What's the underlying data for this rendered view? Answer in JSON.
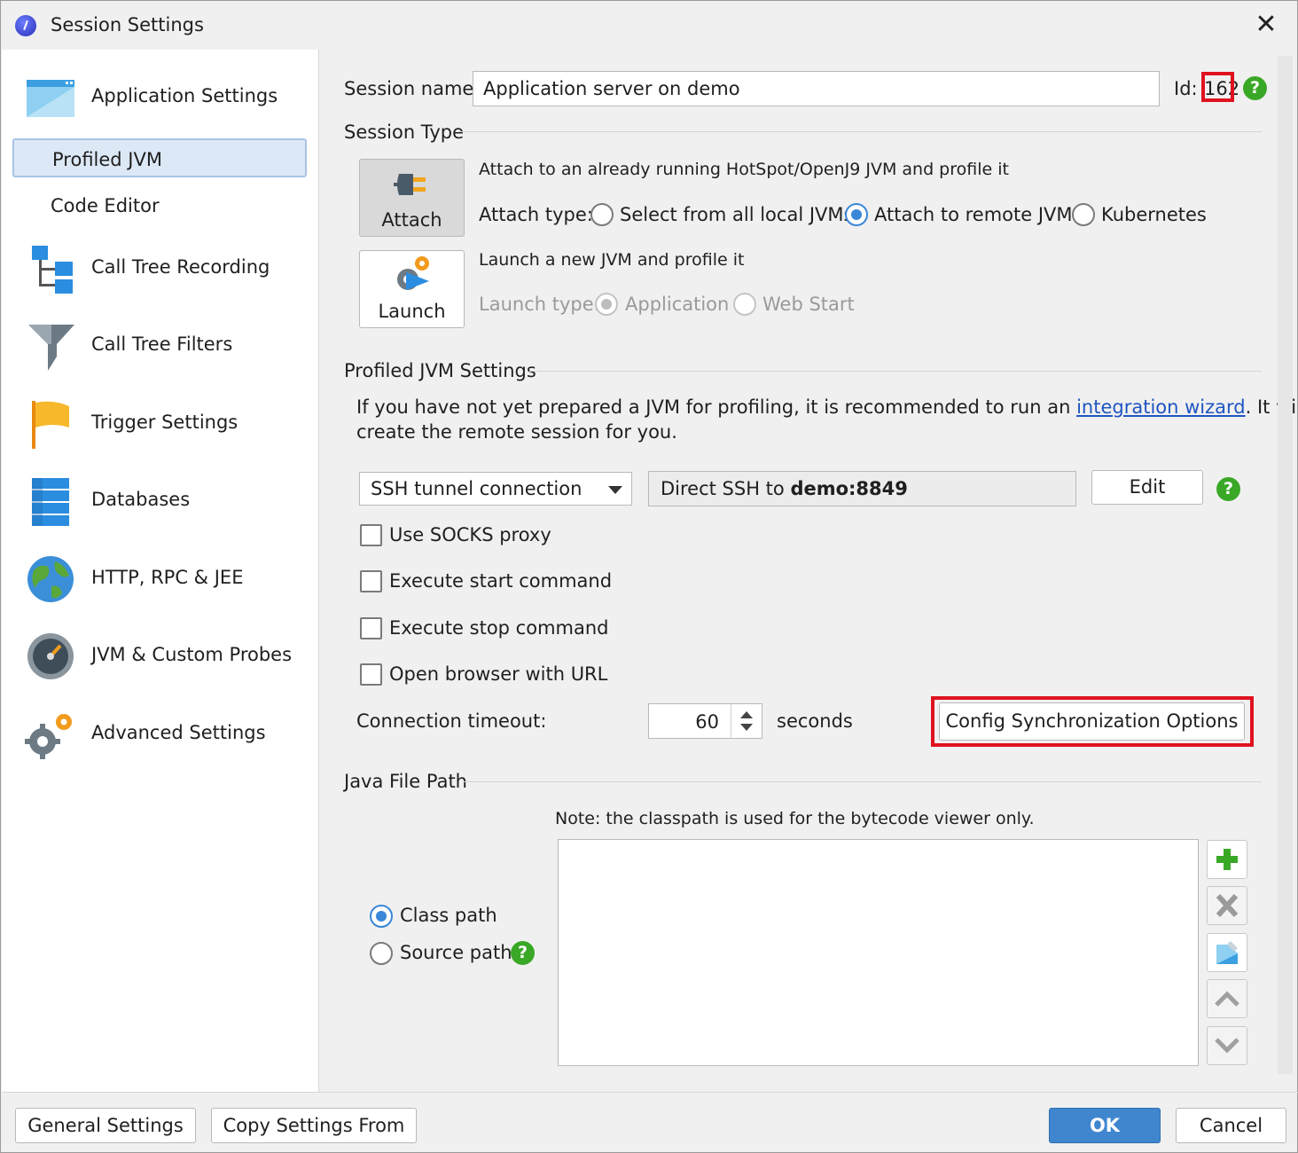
{
  "window": {
    "title": "Session Settings"
  },
  "sidebar": {
    "items": [
      {
        "label": "Application Settings"
      },
      {
        "label": "Profiled JVM"
      },
      {
        "label": "Code Editor"
      },
      {
        "label": "Call Tree Recording"
      },
      {
        "label": "Call Tree Filters"
      },
      {
        "label": "Trigger Settings"
      },
      {
        "label": "Databases"
      },
      {
        "label": "HTTP, RPC & JEE"
      },
      {
        "label": "JVM & Custom Probes"
      },
      {
        "label": "Advanced Settings"
      }
    ]
  },
  "session": {
    "name_label": "Session name:",
    "name_value": "Application server on demo",
    "id_label": "Id:",
    "id_value": "162"
  },
  "session_type": {
    "title": "Session Type",
    "attach_button": "Attach",
    "attach_desc": "Attach to an already running HotSpot/OpenJ9 JVM and profile it",
    "attach_type_label": "Attach type:",
    "attach_options": [
      "Select from all local JVMs",
      "Attach to remote JVM",
      "Kubernetes"
    ],
    "attach_selected": "Attach to remote JVM",
    "launch_button": "Launch",
    "launch_desc": "Launch a new JVM and profile it",
    "launch_type_label": "Launch type:",
    "launch_options": [
      "Application",
      "Web Start"
    ],
    "launch_selected": "Application"
  },
  "jvm_settings": {
    "title": "Profiled JVM Settings",
    "intro_before": "If you have not yet prepared a JVM for profiling, it is recommended to run an ",
    "intro_link": "integration wizard",
    "intro_after": ". It will",
    "intro_line2": "create the remote session for you.",
    "connection_type": "SSH tunnel connection",
    "connection_desc_prefix": "Direct SSH to ",
    "connection_desc_host": "demo:8849",
    "edit_button": "Edit",
    "checkboxes": [
      {
        "label": "Use SOCKS proxy",
        "checked": false
      },
      {
        "label": "Execute start command",
        "checked": false
      },
      {
        "label": "Execute stop command",
        "checked": false
      },
      {
        "label": "Open browser with URL",
        "checked": false
      }
    ],
    "timeout_label": "Connection timeout:",
    "timeout_value": "60",
    "timeout_unit": "seconds",
    "config_sync_button": "Config Synchronization Options"
  },
  "java_file_path": {
    "title": "Java File Path",
    "note": "Note: the classpath is used for the bytecode viewer only.",
    "path_options": [
      "Class path",
      "Source path"
    ],
    "path_selected": "Class path",
    "entries": []
  },
  "footer": {
    "general_settings": "General Settings",
    "copy_settings": "Copy Settings From",
    "ok": "OK",
    "cancel": "Cancel"
  },
  "colors": {
    "accent": "#3f86cf",
    "highlight": "#e0121f",
    "help_green": "#3aa827",
    "selected_item_bg": "#dce8f6"
  }
}
